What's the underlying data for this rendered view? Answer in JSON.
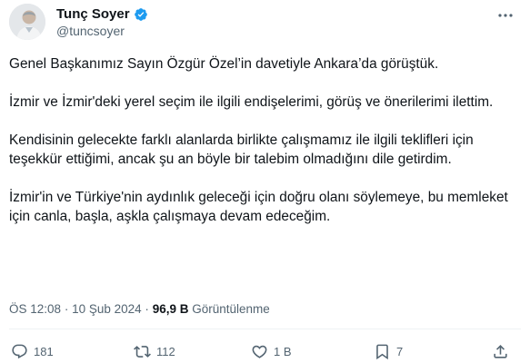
{
  "author": {
    "name": "Tunç Soyer",
    "handle": "@tuncsoyer"
  },
  "tweet": {
    "paragraphs": [
      "Genel Başkanımız Sayın Özgür Özel’in davetiyle Ankara’da görüştük.",
      "İzmir ve İzmir'deki yerel seçim ile ilgili endişelerimi, görüş ve önerilerimi ilettim.",
      "Kendisinin gelecekte farklı alanlarda birlikte çalışmamız ile ilgili teklifleri için teşekkür ettiğimi, ancak şu an böyle bir talebim olmadığını dile getirdim.",
      "İzmir'in ve Türkiye'nin aydınlık geleceği için doğru olanı söylemeye, bu memleket için canla, başla, aşkla çalışmaya devam edeceğim."
    ],
    "time": "ÖS 12:08",
    "separator": "·",
    "date": "10 Şub 2024",
    "views_count": "96,9 B",
    "views_label": "Görüntülenme"
  },
  "actions": {
    "replies": "181",
    "retweets": "112",
    "likes": "1 B",
    "bookmarks": "7"
  },
  "colors": {
    "text": "#0f1419",
    "secondary": "#536471",
    "verified": "#1d9bf0",
    "divider": "#eff3f4"
  },
  "icons": {
    "more": "more-dots-icon",
    "verified": "verified-badge-icon",
    "reply": "reply-icon",
    "retweet": "retweet-icon",
    "like": "heart-icon",
    "bookmark": "bookmark-icon",
    "share": "share-icon"
  }
}
